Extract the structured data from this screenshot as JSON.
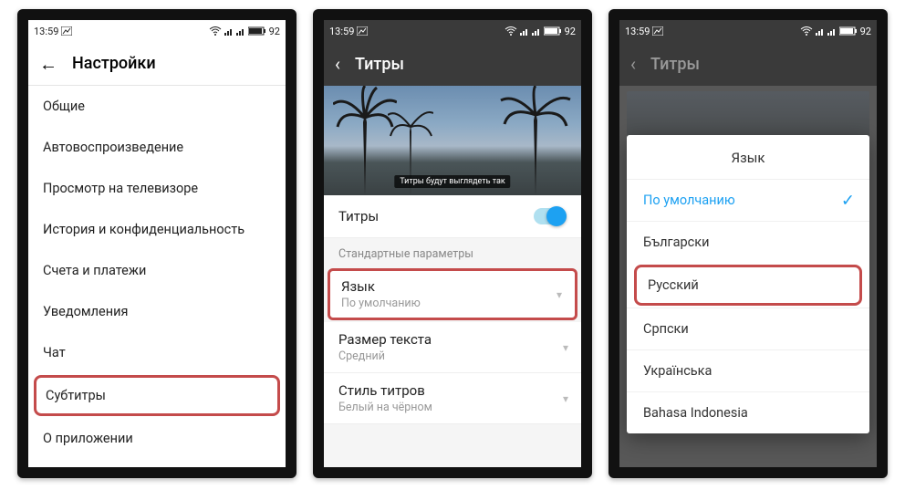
{
  "status": {
    "time": "13:59",
    "battery": "92"
  },
  "screen1": {
    "header": "Настройки",
    "items": [
      "Общие",
      "Автовоспроизведение",
      "Просмотр на телевизоре",
      "История и конфиденциальность",
      "Счета и платежи",
      "Уведомления",
      "Чат",
      "Субтитры",
      "О приложении"
    ]
  },
  "screen2": {
    "header": "Титры",
    "preview_caption": "Титры будут выглядеть так",
    "toggle_label": "Титры",
    "section": "Стандартные параметры",
    "rows": [
      {
        "title": "Язык",
        "value": "По умолчанию"
      },
      {
        "title": "Размер текста",
        "value": "Средний"
      },
      {
        "title": "Стиль титров",
        "value": "Белый на чёрном"
      }
    ]
  },
  "screen3": {
    "header": "Титры",
    "dialog_title": "Язык",
    "languages": [
      "По умолчанию",
      "Български",
      "Русский",
      "Српски",
      "Українська",
      "Bahasa Indonesia"
    ]
  }
}
